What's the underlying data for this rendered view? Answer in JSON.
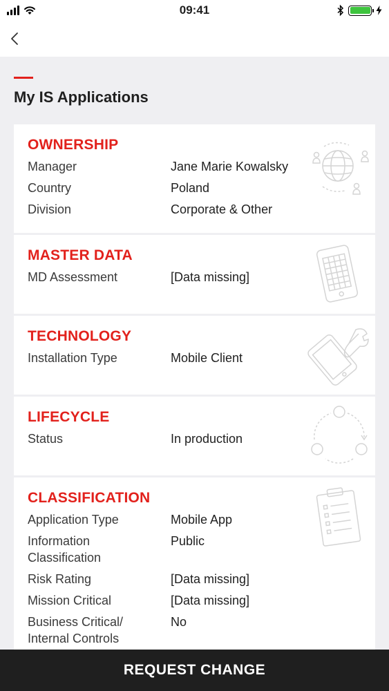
{
  "status_bar": {
    "time": "09:41",
    "battery_color": "#3ec43e"
  },
  "nav": {
    "back_icon": "chevron-left-icon"
  },
  "page": {
    "title": "My IS Applications",
    "accent_color": "#e2211c"
  },
  "sections": {
    "ownership": {
      "title": "OWNERSHIP",
      "icon": "globe-people-icon",
      "rows": [
        {
          "label": "Manager",
          "value": "Jane Marie Kowalsky"
        },
        {
          "label": "Country",
          "value": "Poland"
        },
        {
          "label": "Division",
          "value": "Corporate & Other"
        }
      ]
    },
    "master_data": {
      "title": "MASTER DATA",
      "icon": "tablet-grid-icon",
      "rows": [
        {
          "label": "MD Assessment",
          "value": "[Data missing]"
        }
      ]
    },
    "technology": {
      "title": "TECHNOLOGY",
      "icon": "phone-wrench-icon",
      "rows": [
        {
          "label": "Installation Type",
          "value": "Mobile Client"
        }
      ]
    },
    "lifecycle": {
      "title": "LIFECYCLE",
      "icon": "cycle-icon",
      "rows": [
        {
          "label": "Status",
          "value": "In production"
        }
      ]
    },
    "classification": {
      "title": "CLASSIFICATION",
      "icon": "clipboard-icon",
      "rows": [
        {
          "label": "Application Type",
          "value": "Mobile App"
        },
        {
          "label": "Information Classification",
          "value": "Public"
        },
        {
          "label": "Risk Rating",
          "value": "[Data missing]"
        },
        {
          "label": "Mission Critical",
          "value": "[Data missing]"
        },
        {
          "label": "Business Critical/ Internal Controls",
          "value": "No"
        }
      ]
    }
  },
  "footer": {
    "request_change_label": "REQUEST CHANGE"
  }
}
